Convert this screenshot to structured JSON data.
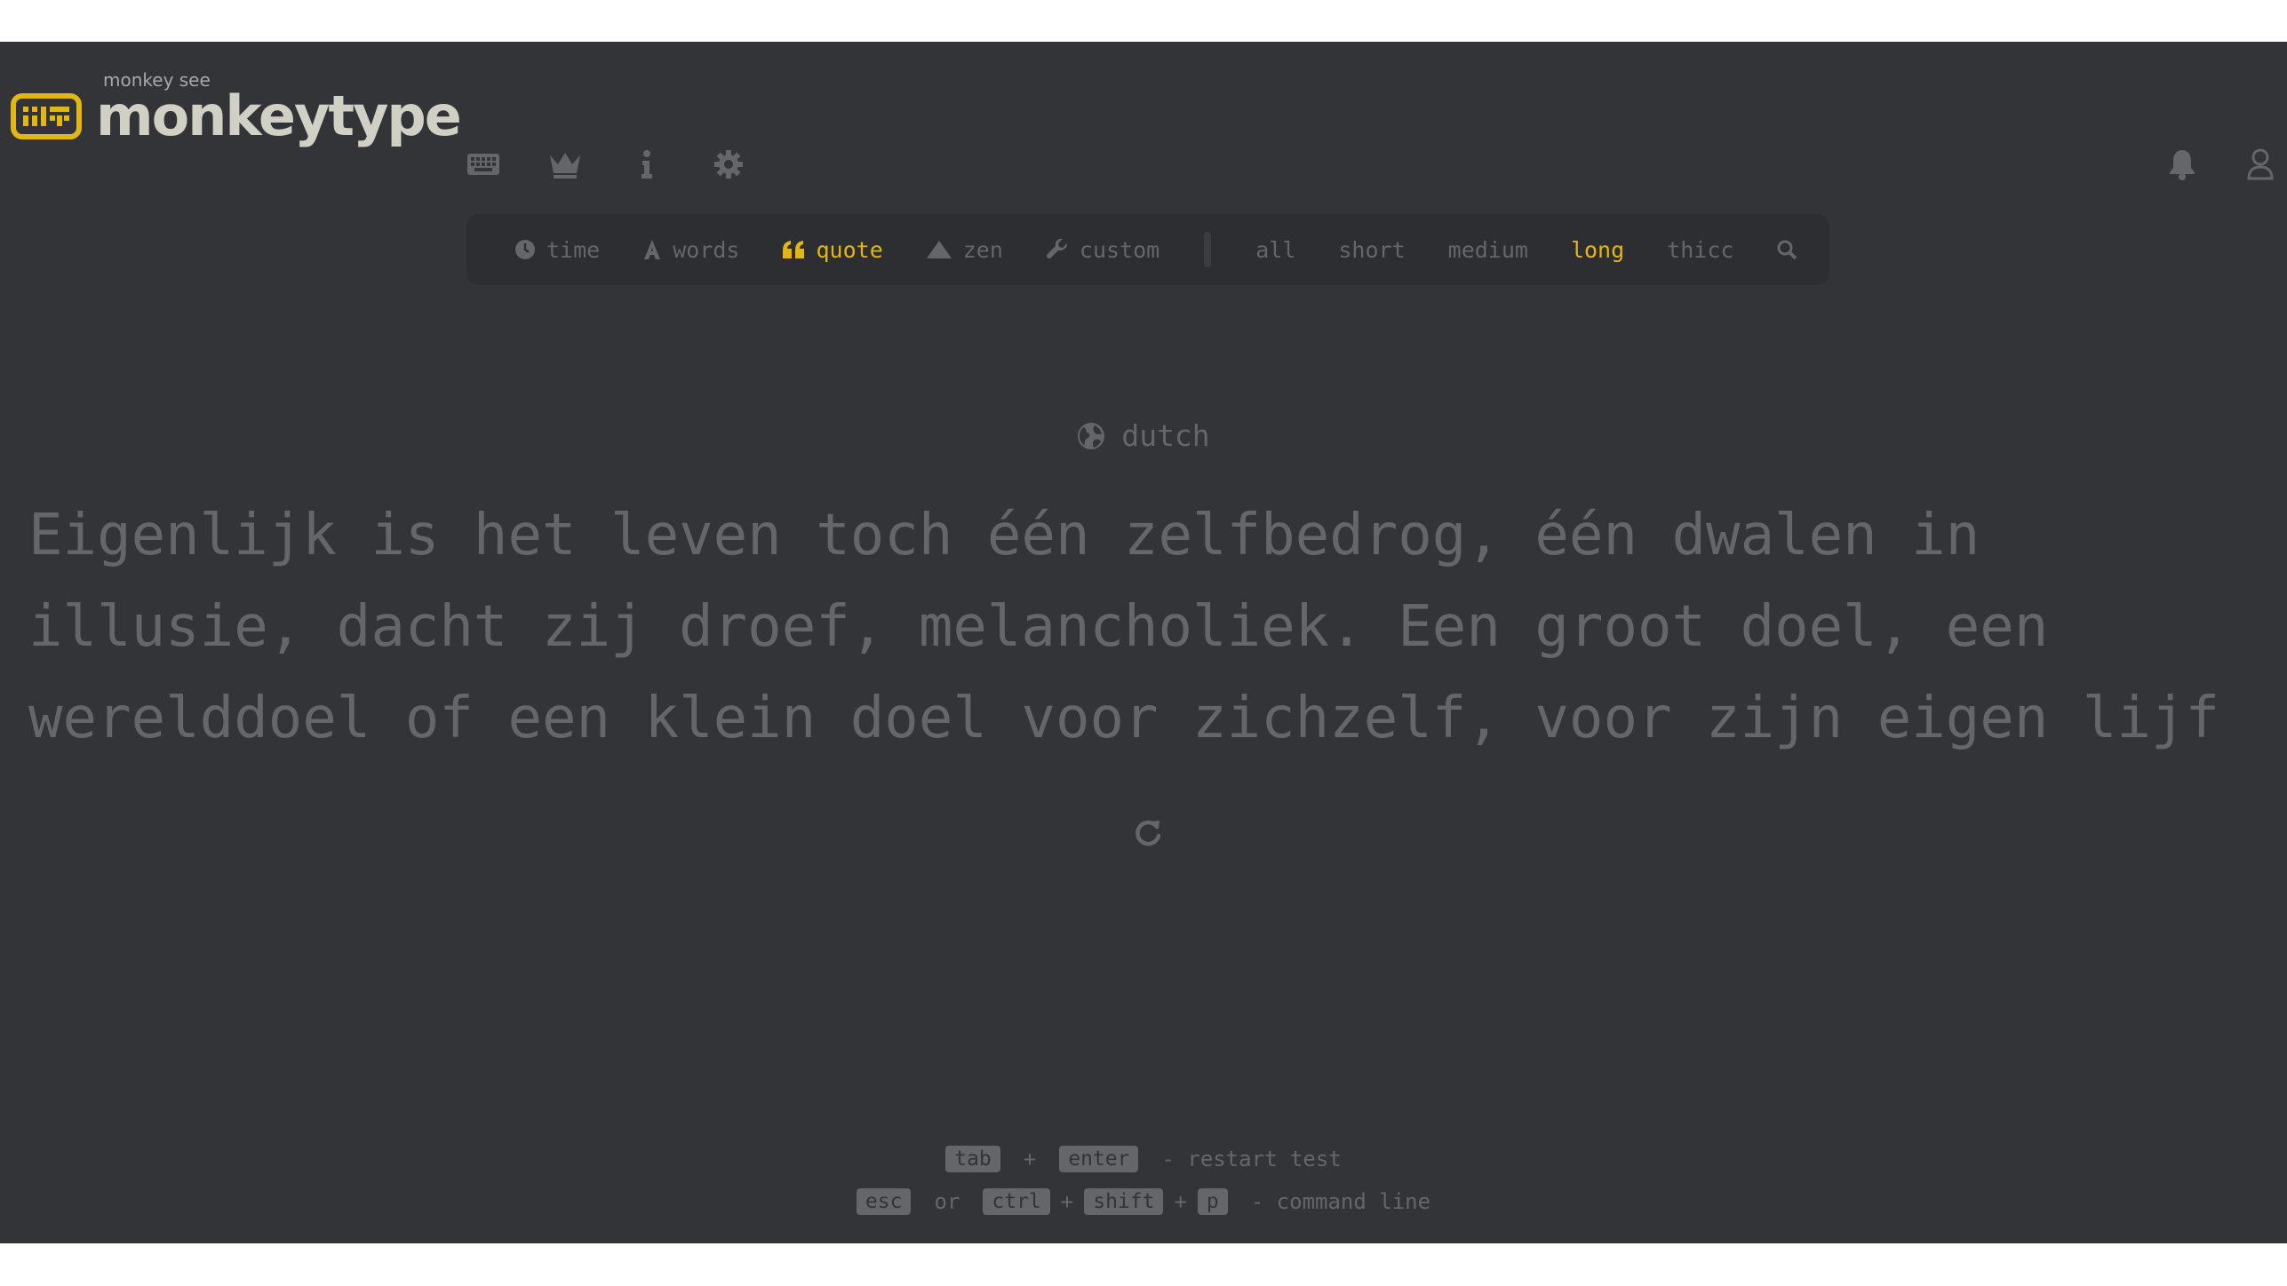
{
  "header": {
    "logo_small": "monkey see",
    "logo_big": "monkeytype",
    "nav": [
      {
        "icon": "keyboard-icon"
      },
      {
        "icon": "crown-icon"
      },
      {
        "icon": "info-icon"
      },
      {
        "icon": "gear-icon"
      }
    ],
    "right": [
      {
        "icon": "bell-icon"
      },
      {
        "icon": "user-icon"
      }
    ]
  },
  "config": {
    "modes": [
      {
        "label": "time",
        "icon": "clock-icon",
        "active": false
      },
      {
        "label": "words",
        "icon": "font-a-icon",
        "active": false
      },
      {
        "label": "quote",
        "icon": "quote-icon",
        "active": true
      },
      {
        "label": "zen",
        "icon": "mountain-icon",
        "active": false
      },
      {
        "label": "custom",
        "icon": "wrench-icon",
        "active": false
      }
    ],
    "lengths": [
      {
        "label": "all",
        "active": false
      },
      {
        "label": "short",
        "active": false
      },
      {
        "label": "medium",
        "active": false
      },
      {
        "label": "long",
        "active": true
      },
      {
        "label": "thicc",
        "active": false
      }
    ],
    "search_icon": "search-icon"
  },
  "test": {
    "language": "dutch",
    "language_icon": "globe-icon",
    "lines": [
      "Eigenlijk is het leven toch één zelfbedrog, één dwalen in",
      "illusie, dacht zij droef, melancholiek. Een groot doel, een",
      "werelddoel of een klein doel voor zichzelf, voor zijn eigen lijf"
    ],
    "restart_icon": "restart-icon"
  },
  "keytips": {
    "row1": {
      "k1": "tab",
      "plus": "+",
      "k2": "enter",
      "desc": "- restart test"
    },
    "row2": {
      "k1": "esc",
      "or": "or",
      "k2": "ctrl",
      "plus1": "+",
      "k3": "shift",
      "plus2": "+",
      "k4": "p",
      "desc": "- command line"
    }
  },
  "colors": {
    "background": "#323437",
    "sub": "#646669",
    "main": "#e2b714",
    "text": "#d1d0c5"
  }
}
